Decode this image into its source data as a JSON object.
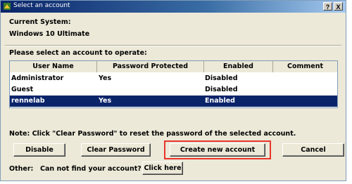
{
  "window": {
    "title": "Select an account",
    "help_label": "?",
    "close_label": "X"
  },
  "current_system": {
    "label": "Current System:",
    "value": "Windows 10 Ultimate"
  },
  "instruction": "Please select an account to operate:",
  "accounts_table": {
    "headers": [
      "User Name",
      "Password Protected",
      "Enabled",
      "Comment"
    ],
    "rows": [
      {
        "user": "Administrator",
        "protected": "Yes",
        "enabled": "Disabled",
        "comment": "",
        "selected": false
      },
      {
        "user": "Guest",
        "protected": "",
        "enabled": "Disabled",
        "comment": "",
        "selected": false
      },
      {
        "user": "rennelab",
        "protected": "Yes",
        "enabled": "Enabled",
        "comment": "",
        "selected": true
      }
    ]
  },
  "note": "Note: Click \"Clear Password\" to reset the password of the selected account.",
  "buttons": {
    "disable": "Disable",
    "clear_password": "Clear Password",
    "create_account": "Create new account",
    "cancel": "Cancel"
  },
  "other": {
    "label": "Other:",
    "question": "Can not find your account?",
    "click_here": "Click here"
  },
  "colors": {
    "title_bar": "#0a246a",
    "selection": "#0a246a",
    "highlight_box": "#e8352b",
    "face": "#ece9d8"
  }
}
